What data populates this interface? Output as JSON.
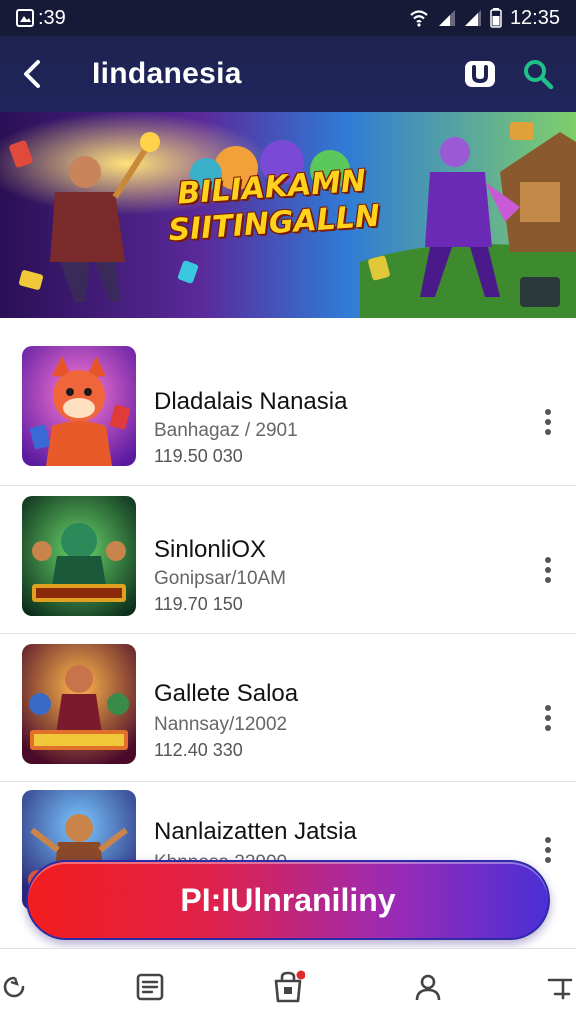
{
  "status_bar": {
    "left_text": ":39",
    "time": "12:35"
  },
  "header": {
    "title": "Iindanesia"
  },
  "banner": {
    "title": "BILIAKAMN SIITINGALLN"
  },
  "items": [
    {
      "title": "Dladalais Nanasia",
      "subtitle": "Banhagaz / 2901",
      "meta": "119.50 030"
    },
    {
      "title": "SinlonliOX",
      "subtitle": "Gonipsar/10AM",
      "meta": "119.70 150"
    },
    {
      "title": "Gallete Saloa",
      "subtitle": "Nannsay/12002",
      "meta": "112.40 330"
    },
    {
      "title": "Nanlaizatten Jatsia",
      "subtitle": "Khnnosa 22900",
      "meta": ""
    }
  ],
  "cta": {
    "label": "PI:IUlnraniliny"
  },
  "colors": {
    "header_bg": "#20265c",
    "cta_start": "#f21d1d",
    "cta_end": "#4a2fd6",
    "accent_green": "#21c08a"
  },
  "icons": {
    "back": "back-arrow-icon",
    "badge": "u-badge-icon",
    "search": "search-icon",
    "more": "more-vertical-icon",
    "nav": [
      "refresh-icon",
      "list-icon",
      "shop-bag-icon",
      "profile-icon",
      "share-icon"
    ]
  }
}
